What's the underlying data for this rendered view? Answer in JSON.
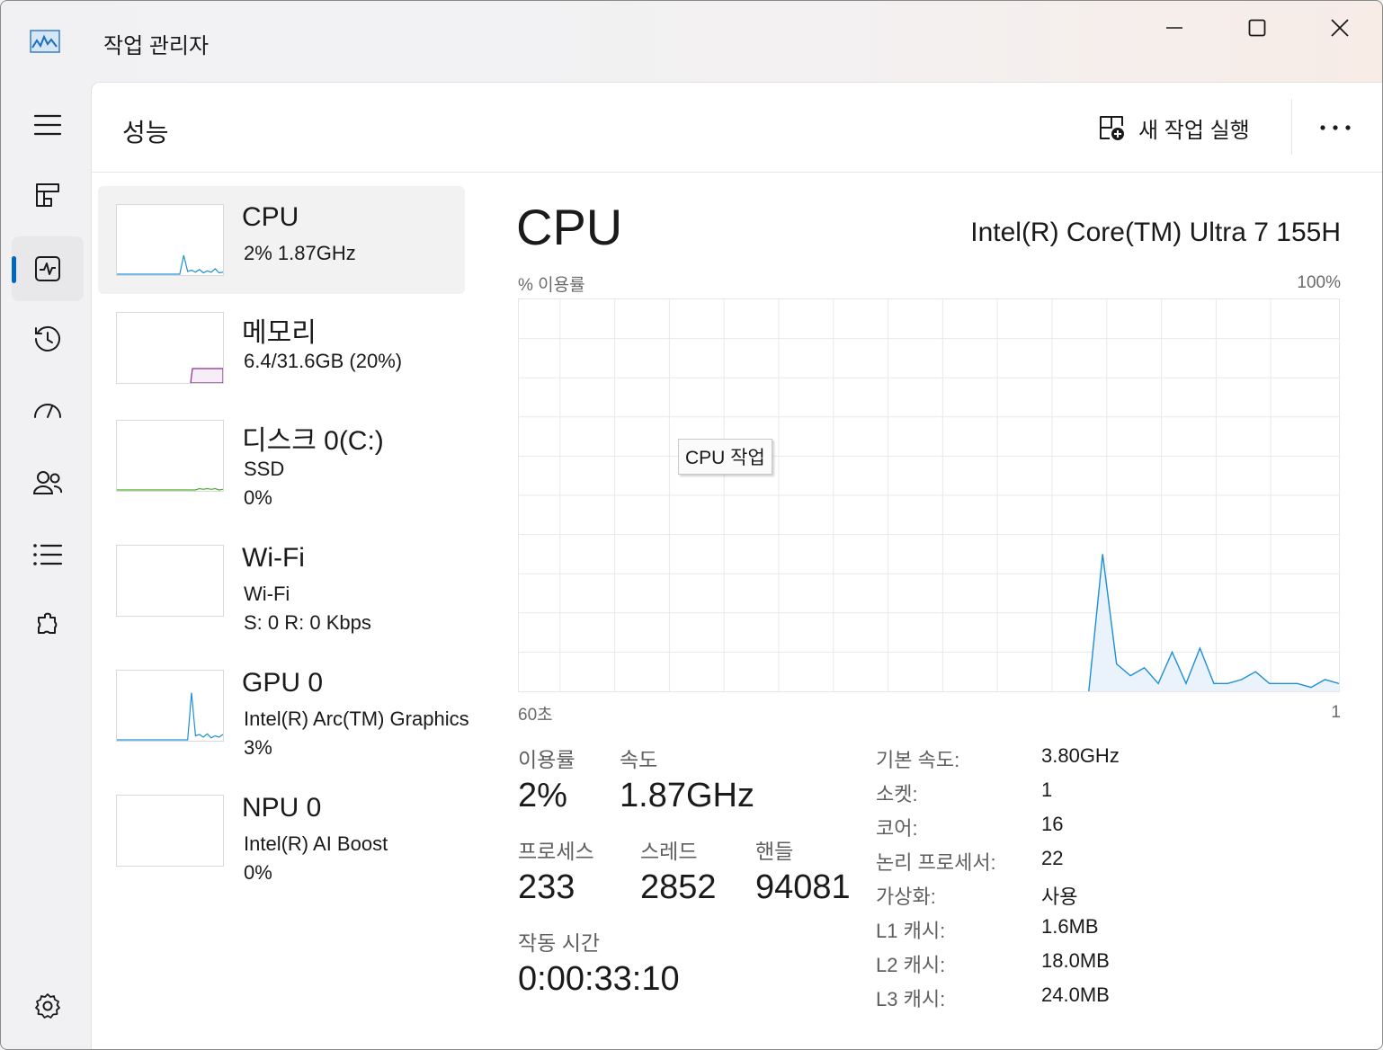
{
  "app": {
    "title": "작업 관리자",
    "icon": "performance-graph-icon"
  },
  "nav": {
    "items": [
      {
        "name": "hamburger-menu-icon"
      },
      {
        "name": "processes-icon"
      },
      {
        "name": "performance-icon",
        "active": true
      },
      {
        "name": "app-history-icon"
      },
      {
        "name": "startup-apps-icon"
      },
      {
        "name": "users-icon"
      },
      {
        "name": "details-icon"
      },
      {
        "name": "services-icon"
      },
      {
        "name": "settings-icon"
      }
    ]
  },
  "header": {
    "title": "성능",
    "run_task_label": "새 작업 실행",
    "run_task_icon": "new-task-icon",
    "more_icon": "more-options-icon"
  },
  "resources": [
    {
      "name": "CPU",
      "sub1": "2%  1.87GHz",
      "sub2": "",
      "color": "#1c8fd6"
    },
    {
      "name": "메모리",
      "sub1": "6.4/31.6GB (20%)",
      "sub2": "",
      "color": "#8e2d8e"
    },
    {
      "name": "디스크 0(C:)",
      "sub1": "SSD",
      "sub2": "0%",
      "color": "#4caf2e"
    },
    {
      "name": "Wi-Fi",
      "sub1": "Wi-Fi",
      "sub2": "S: 0  R: 0 Kbps",
      "color": "#a6652a"
    },
    {
      "name": "GPU 0",
      "sub1": "Intel(R) Arc(TM) Graphics",
      "sub2": "3%",
      "color": "#1c8fd6"
    },
    {
      "name": "NPU 0",
      "sub1": "Intel(R) AI Boost",
      "sub2": "0%",
      "color": "#1c8fd6"
    }
  ],
  "detail": {
    "title": "CPU",
    "model": "Intel(R) Core(TM) Ultra 7 155H",
    "y_label": "% 이용률",
    "y_max": "100%",
    "x_left": "60초",
    "x_right": "1",
    "tooltip": "CPU 작업",
    "line_color": "#1c8fd6",
    "fill_color": "#eaf3fb"
  },
  "chart_data": {
    "type": "area",
    "x_unit": "seconds ago",
    "x": [
      60,
      59,
      58,
      57,
      56,
      55,
      54,
      53,
      52,
      51,
      50,
      49,
      48,
      47,
      46,
      45,
      44,
      43,
      42,
      41,
      40,
      39,
      38,
      37,
      36,
      35,
      34,
      33,
      32,
      31,
      30,
      29,
      28,
      27,
      26,
      25,
      24,
      23,
      22,
      21,
      20,
      19,
      18,
      17,
      16,
      15,
      14,
      13,
      12,
      11,
      10,
      9,
      8,
      7,
      6,
      5,
      4,
      3,
      2,
      1
    ],
    "y": [
      0,
      0,
      0,
      0,
      0,
      0,
      0,
      0,
      0,
      0,
      0,
      0,
      0,
      0,
      0,
      0,
      0,
      0,
      0,
      0,
      0,
      0,
      0,
      0,
      0,
      0,
      0,
      0,
      0,
      0,
      0,
      0,
      0,
      0,
      0,
      0,
      0,
      0,
      0,
      0,
      0,
      0,
      35,
      7,
      4,
      6,
      2,
      10,
      2,
      11,
      2,
      2,
      3,
      5,
      2,
      2,
      2,
      1,
      3,
      2
    ],
    "ylim": [
      0,
      100
    ],
    "grid": true
  },
  "stats": {
    "util_label": "이용률",
    "util_value": "2%",
    "speed_label": "속도",
    "speed_value": "1.87GHz",
    "proc_label": "프로세스",
    "proc_value": "233",
    "thread_label": "스레드",
    "thread_value": "2852",
    "handle_label": "핸들",
    "handle_value": "94081",
    "uptime_label": "작동 시간",
    "uptime_value": "0:00:33:10"
  },
  "specs": [
    {
      "k": "기본 속도:",
      "v": "3.80GHz"
    },
    {
      "k": "소켓:",
      "v": "1"
    },
    {
      "k": "코어:",
      "v": "16"
    },
    {
      "k": "논리 프로세서:",
      "v": "22"
    },
    {
      "k": "가상화:",
      "v": "사용"
    },
    {
      "k": "L1 캐시:",
      "v": "1.6MB"
    },
    {
      "k": "L2 캐시:",
      "v": "18.0MB"
    },
    {
      "k": "L3 캐시:",
      "v": "24.0MB"
    }
  ]
}
